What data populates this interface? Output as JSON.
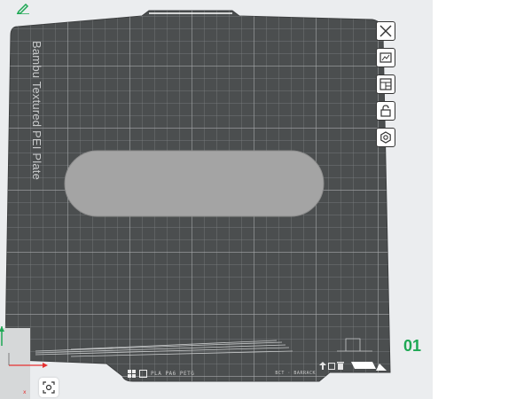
{
  "plate": {
    "name": "Bambu Textured PEI Plate",
    "number": "01",
    "filament_types": "PLA PA6 PETG",
    "bottom_small_text": "BCT · BARRACK"
  },
  "toolbar": {
    "buttons": [
      {
        "name": "close",
        "icon": "close-icon"
      },
      {
        "name": "arrange",
        "icon": "arrange-icon"
      },
      {
        "name": "layout",
        "icon": "layout-icon"
      },
      {
        "name": "lock",
        "icon": "lock-icon"
      },
      {
        "name": "settings",
        "icon": "settings-icon"
      }
    ]
  },
  "colors": {
    "plate": "#4b4e4f",
    "grid": "#7f8384",
    "grid_major": "#9a9d9e",
    "object": "#a4a4a4",
    "accent_green": "#1ea854"
  }
}
